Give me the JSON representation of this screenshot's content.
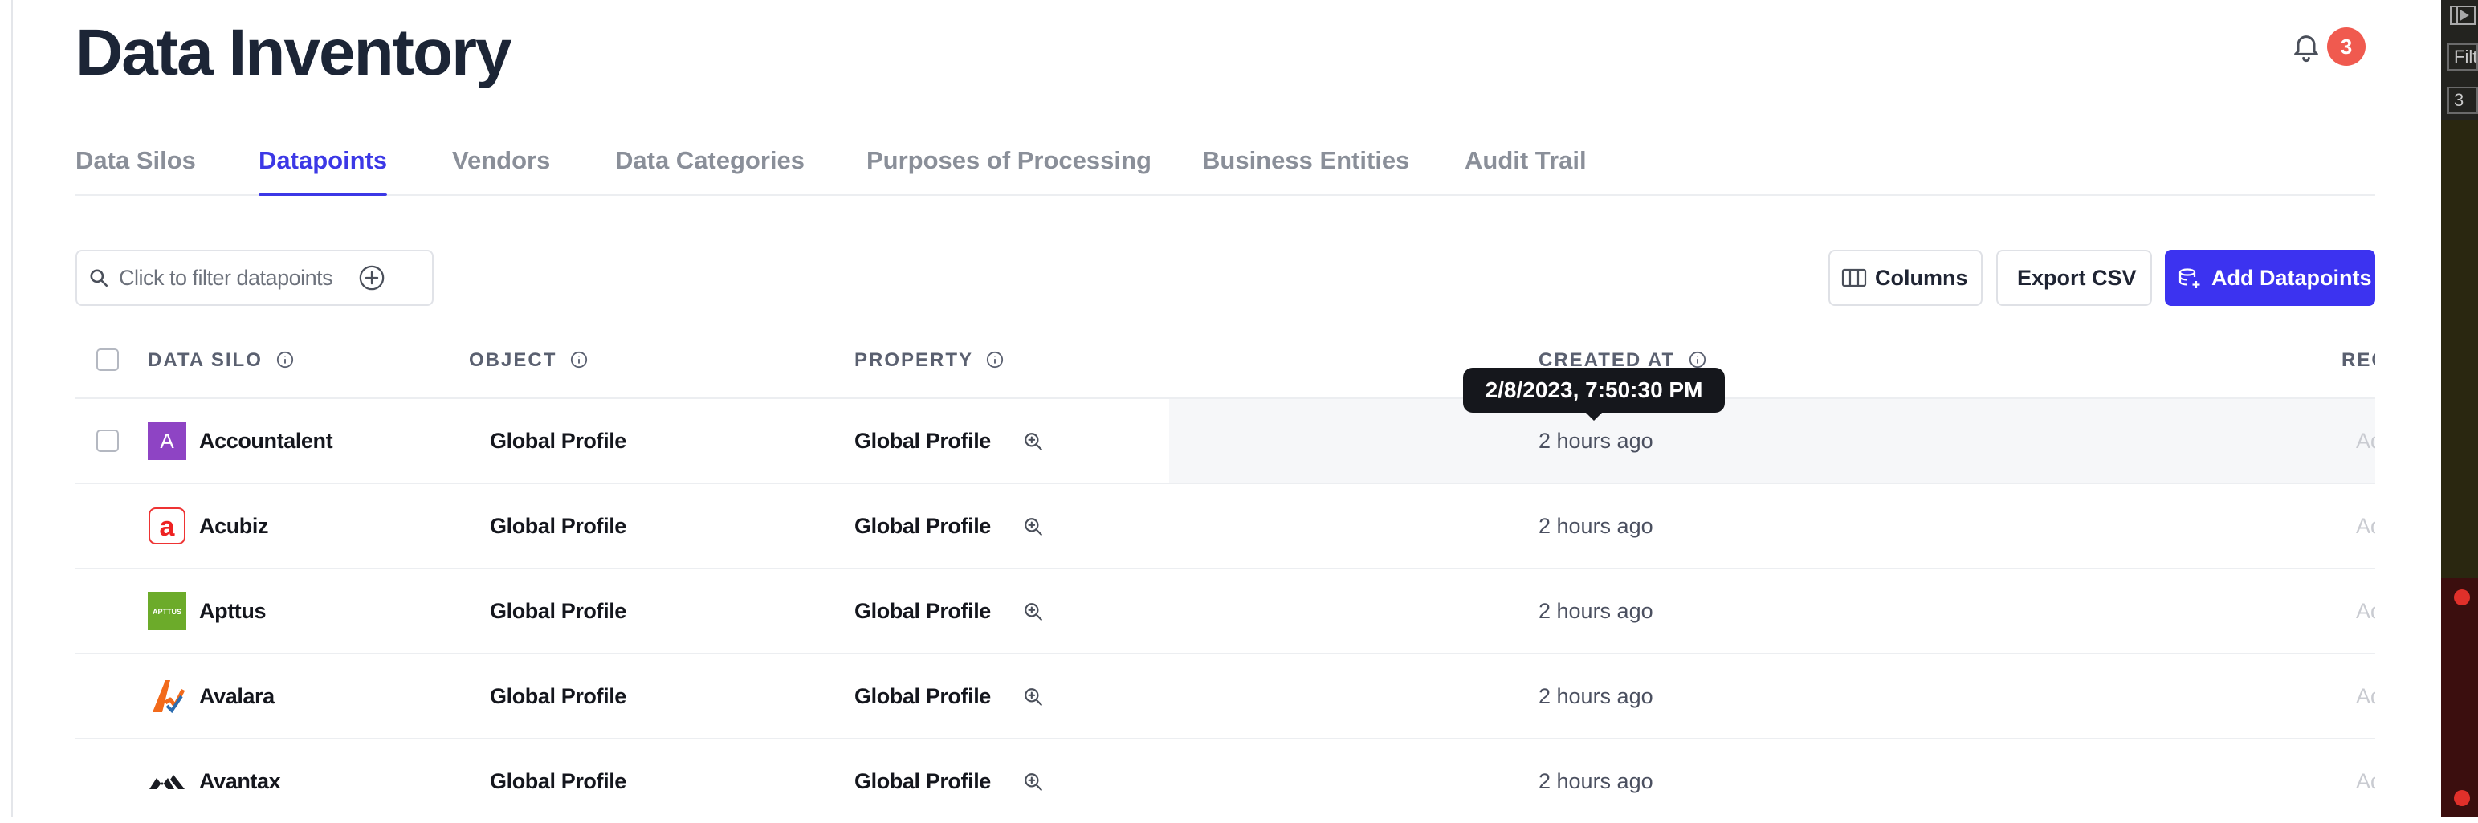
{
  "header": {
    "title": "Data Inventory",
    "notification_count": "3"
  },
  "tabs": [
    {
      "label": "Data Silos",
      "active": false
    },
    {
      "label": "Datapoints",
      "active": true
    },
    {
      "label": "Vendors",
      "active": false
    },
    {
      "label": "Data Categories",
      "active": false
    },
    {
      "label": "Purposes of Processing",
      "active": false
    },
    {
      "label": "Business Entities",
      "active": false
    },
    {
      "label": "Audit Trail",
      "active": false
    }
  ],
  "toolbar": {
    "filter_placeholder": "Click to filter datapoints",
    "columns_label": "Columns",
    "export_label": "Export CSV",
    "add_label": "Add Datapoints"
  },
  "table": {
    "columns": {
      "data_silo": "DATA SILO",
      "object": "OBJECT",
      "property": "PROPERTY",
      "created_at": "CREATED AT",
      "truncated": "REC"
    },
    "rows": [
      {
        "silo": "Accountalent",
        "logo": "accountalent-logo",
        "object": "Global Profile",
        "property": "Global Profile",
        "created": "2 hours ago",
        "extra": "Ad"
      },
      {
        "silo": "Acubiz",
        "logo": "acubiz-logo",
        "object": "Global Profile",
        "property": "Global Profile",
        "created": "2 hours ago",
        "extra": "Ad"
      },
      {
        "silo": "Apttus",
        "logo": "apttus-logo",
        "object": "Global Profile",
        "property": "Global Profile",
        "created": "2 hours ago",
        "extra": "Ad"
      },
      {
        "silo": "Avalara",
        "logo": "avalara-logo",
        "object": "Global Profile",
        "property": "Global Profile",
        "created": "2 hours ago",
        "extra": "Ad"
      },
      {
        "silo": "Avantax",
        "logo": "avantax-logo",
        "object": "Global Profile",
        "property": "Global Profile",
        "created": "2 hours ago",
        "extra": "Ad"
      }
    ]
  },
  "tooltip": {
    "text": "2/8/2023, 7:50:30 PM"
  },
  "logos": {
    "accountalent_letter": "A",
    "acubiz_letter": "a",
    "apttus_text": "APTTUS"
  },
  "side_panel": {
    "filter_text": "Filt",
    "count_text": "3"
  },
  "colors": {
    "accent": "#3c33f0",
    "badge": "#f05a4f",
    "tooltip": "#15171c"
  }
}
